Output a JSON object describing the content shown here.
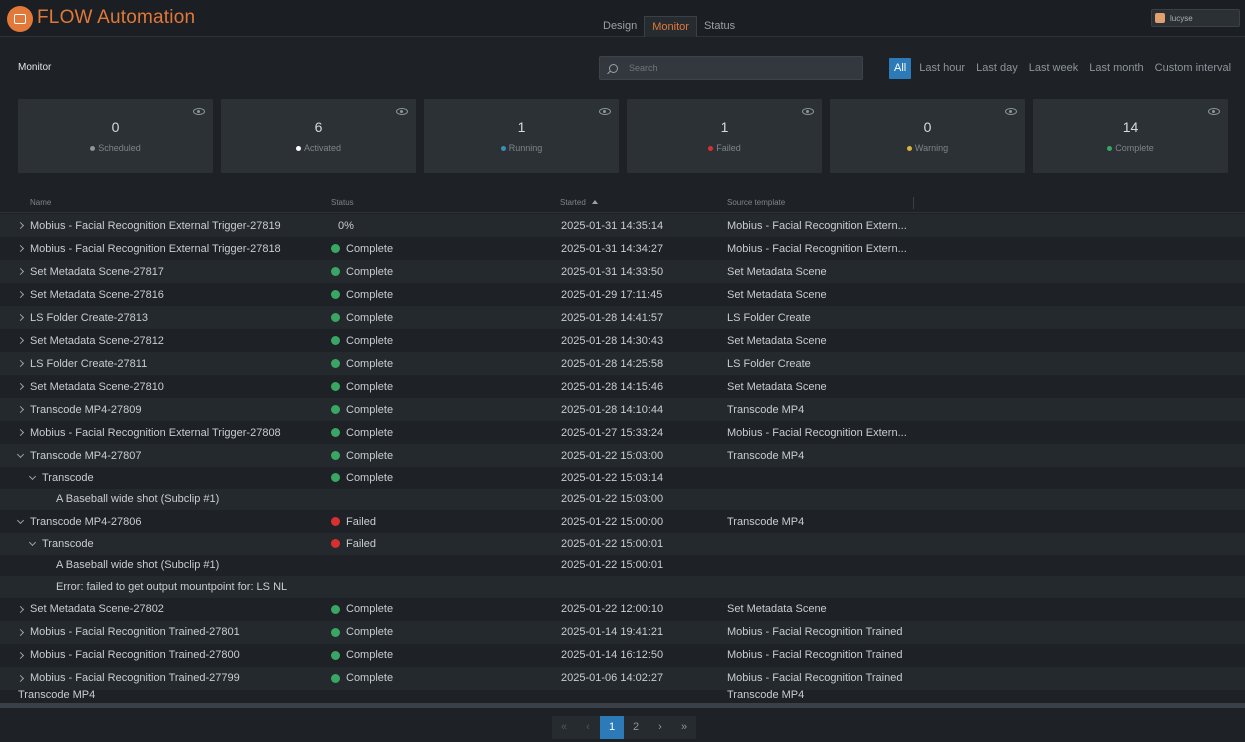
{
  "app": {
    "title": "FLOW Automation",
    "logo_icon": "flow-logo-icon"
  },
  "tabs": [
    {
      "label": "Design"
    },
    {
      "label": "Monitor",
      "active": true
    },
    {
      "label": "Status"
    }
  ],
  "user": {
    "name": "lucyse"
  },
  "page": {
    "title": "Monitor"
  },
  "search": {
    "placeholder": "Search"
  },
  "time_filters": [
    "All",
    "Last hour",
    "Last day",
    "Last week",
    "Last month",
    "Custom interval"
  ],
  "cards": [
    {
      "count": "0",
      "label": "Scheduled",
      "color": "#8d949b"
    },
    {
      "count": "6",
      "label": "Activated",
      "color": "#ffffff"
    },
    {
      "count": "1",
      "label": "Running",
      "color": "#3a8fb8"
    },
    {
      "count": "1",
      "label": "Failed",
      "color": "#d83030"
    },
    {
      "count": "0",
      "label": "Warning",
      "color": "#d9b43a"
    },
    {
      "count": "14",
      "label": "Complete",
      "color": "#3aa663"
    }
  ],
  "table": {
    "headers": {
      "name": "Name",
      "status": "Status",
      "started": "Started",
      "source": "Source template"
    },
    "rows": [
      {
        "level": 0,
        "expand": "collapsed",
        "name": "Mobius - Facial Recognition External Trigger-27819",
        "status": "0%",
        "state": "running",
        "started": "2025-01-31 14:35:14",
        "source": "Mobius - Facial Recognition Extern..."
      },
      {
        "level": 0,
        "expand": "collapsed",
        "name": "Mobius - Facial Recognition External Trigger-27818",
        "status": "Complete",
        "state": "complete",
        "started": "2025-01-31 14:34:27",
        "source": "Mobius - Facial Recognition Extern..."
      },
      {
        "level": 0,
        "expand": "collapsed",
        "name": "Set Metadata Scene-27817",
        "status": "Complete",
        "state": "complete",
        "started": "2025-01-31 14:33:50",
        "source": "Set Metadata Scene"
      },
      {
        "level": 0,
        "expand": "collapsed",
        "name": "Set Metadata Scene-27816",
        "status": "Complete",
        "state": "complete",
        "started": "2025-01-29 17:11:45",
        "source": "Set Metadata Scene"
      },
      {
        "level": 0,
        "expand": "collapsed",
        "name": "LS Folder Create-27813",
        "status": "Complete",
        "state": "complete",
        "started": "2025-01-28 14:41:57",
        "source": "LS Folder Create"
      },
      {
        "level": 0,
        "expand": "collapsed",
        "name": "Set Metadata Scene-27812",
        "status": "Complete",
        "state": "complete",
        "started": "2025-01-28 14:30:43",
        "source": "Set Metadata Scene"
      },
      {
        "level": 0,
        "expand": "collapsed",
        "name": "LS Folder Create-27811",
        "status": "Complete",
        "state": "complete",
        "started": "2025-01-28 14:25:58",
        "source": "LS Folder Create"
      },
      {
        "level": 0,
        "expand": "collapsed",
        "name": "Set Metadata Scene-27810",
        "status": "Complete",
        "state": "complete",
        "started": "2025-01-28 14:15:46",
        "source": "Set Metadata Scene"
      },
      {
        "level": 0,
        "expand": "collapsed",
        "name": "Transcode MP4-27809",
        "status": "Complete",
        "state": "complete",
        "started": "2025-01-28 14:10:44",
        "source": "Transcode MP4"
      },
      {
        "level": 0,
        "expand": "collapsed",
        "name": "Mobius - Facial Recognition External Trigger-27808",
        "status": "Complete",
        "state": "complete",
        "started": "2025-01-27 15:33:24",
        "source": "Mobius - Facial Recognition Extern..."
      },
      {
        "level": 0,
        "expand": "expanded",
        "name": "Transcode MP4-27807",
        "status": "Complete",
        "state": "complete",
        "started": "2025-01-22 15:03:00",
        "source": "Transcode MP4"
      },
      {
        "level": 1,
        "expand": "expanded",
        "name": "Transcode",
        "status": "Complete",
        "state": "complete",
        "started": "2025-01-22 15:03:14",
        "source": ""
      },
      {
        "level": 2,
        "expand": "none",
        "name": "A Baseball wide shot (Subclip #1)",
        "status": "",
        "state": "none",
        "started": "2025-01-22 15:03:00",
        "source": ""
      },
      {
        "level": 0,
        "expand": "expanded",
        "name": "Transcode MP4-27806",
        "status": "Failed",
        "state": "failed",
        "started": "2025-01-22 15:00:00",
        "source": "Transcode MP4"
      },
      {
        "level": 1,
        "expand": "expanded",
        "name": "Transcode",
        "status": "Failed",
        "state": "failed",
        "started": "2025-01-22 15:00:01",
        "source": ""
      },
      {
        "level": 2,
        "expand": "none",
        "name": "A Baseball wide shot (Subclip #1)",
        "status": "",
        "state": "none",
        "started": "2025-01-22 15:00:01",
        "source": ""
      },
      {
        "level": 2,
        "expand": "none",
        "name": "Error: failed to get output mountpoint for: LS NL",
        "status": "",
        "state": "none",
        "started": "",
        "source": ""
      },
      {
        "level": 0,
        "expand": "collapsed",
        "name": "Set Metadata Scene-27802",
        "status": "Complete",
        "state": "complete",
        "started": "2025-01-22 12:00:10",
        "source": "Set Metadata Scene"
      },
      {
        "level": 0,
        "expand": "collapsed",
        "name": "Mobius - Facial Recognition Trained-27801",
        "status": "Complete",
        "state": "complete",
        "started": "2025-01-14 19:41:21",
        "source": "Mobius - Facial Recognition Trained"
      },
      {
        "level": 0,
        "expand": "collapsed",
        "name": "Mobius - Facial Recognition Trained-27800",
        "status": "Complete",
        "state": "complete",
        "started": "2025-01-14 16:12:50",
        "source": "Mobius - Facial Recognition Trained"
      },
      {
        "level": 0,
        "expand": "collapsed",
        "name": "Mobius - Facial Recognition Trained-27799",
        "status": "Complete",
        "state": "complete",
        "started": "2025-01-06 14:02:27",
        "source": "Mobius - Facial Recognition Trained"
      },
      {
        "level": 0,
        "expand": "none",
        "name": "Transcode MP4",
        "status": "",
        "state": "none",
        "started": "",
        "source": "Transcode MP4",
        "partial": true
      }
    ]
  },
  "pagination": {
    "first": "«",
    "prev": "‹",
    "pages": [
      "1",
      "2"
    ],
    "current": "1",
    "next": "›",
    "last": "»"
  }
}
